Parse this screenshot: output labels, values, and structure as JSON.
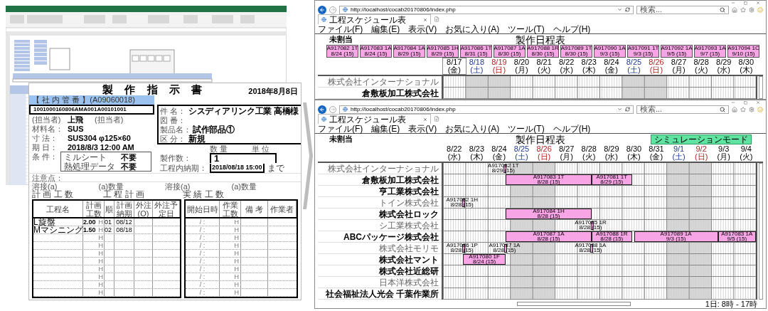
{
  "work_order": {
    "title": "製 作 指 示 書",
    "date": "2018年8月8日",
    "control_label": "【 社 内 管 番 】(A09060018)",
    "code": "1001000160806AMA001A00101001",
    "left_fields": [
      {
        "label": "(担当者)",
        "value": "上飛",
        "extra": "(担当者)"
      },
      {
        "label": "材料名：",
        "value": "SUS"
      },
      {
        "label": "寸 法：",
        "value": "SUS304 φ125×60"
      },
      {
        "label": "期 日：",
        "value": "2018/8/3 12:00 AM"
      }
    ],
    "conditions_label": "条 件：",
    "conditions": [
      {
        "label": "ミルシート",
        "value": "不要"
      },
      {
        "label": "熱処理データ",
        "value": "不要"
      }
    ],
    "right_fields": [
      {
        "label": "件 名：",
        "value": "シスディアリンク工業 高橋様"
      },
      {
        "label": "図 番："
      },
      {
        "label": "製品名：",
        "value": "試作部品①"
      },
      {
        "label": "区 分：",
        "value": "新規"
      }
    ],
    "quantity_headers": [
      "数 量",
      "単 位"
    ],
    "quantity": {
      "label": "製作数：",
      "value": "1"
    },
    "due": {
      "label": "工程内納期：",
      "value": "2018/08/18 15:00",
      "suffix": "まで"
    },
    "notes_label": "注意点：",
    "weld_labels": [
      "溶接(a)",
      "(a)数量",
      "溶接(a)",
      "(a)数量"
    ],
    "sections": [
      "計 画 工 数",
      "工 程 計 画",
      "実 績 工 数"
    ],
    "plan_columns": [
      "工程名",
      "計画工数",
      "順",
      "計画納期",
      "外注(O)",
      "外注予定日"
    ],
    "actual_columns": [
      "開始日時",
      "作業工数",
      "備 考",
      "作業者"
    ],
    "rows": [
      {
        "process": "L旋盤",
        "hours": "2.00",
        "hours_unit": "H",
        "order": "01",
        "due": "08/12",
        "start": "/ :",
        "work_unit": "H"
      },
      {
        "process": "Mマシニング",
        "hours": "1.50",
        "hours_unit": "H",
        "order": "02",
        "due": "08/18",
        "start": "/ :",
        "work_unit": "H"
      },
      {
        "hours_unit": "H",
        "start": "/ :",
        "work_unit": "H"
      },
      {
        "hours_unit": "H",
        "start": "/ :",
        "work_unit": "H"
      },
      {
        "hours_unit": "H",
        "start": "/ :",
        "work_unit": "H"
      },
      {
        "hours_unit": "H",
        "start": "/ :",
        "work_unit": "H"
      },
      {
        "hours_unit": "H",
        "start": "/ :",
        "work_unit": "H"
      },
      {
        "hours_unit": "H",
        "start": "/ :",
        "work_unit": "H"
      },
      {
        "hours_unit": "H",
        "start": "/ :",
        "work_unit": "H"
      },
      {
        "hours_unit": "H",
        "start": "/ :",
        "work_unit": "H"
      }
    ]
  },
  "browsers": [
    {
      "url": "http://localhost/cocab20170806/index.php",
      "search_placeholder": "検索...",
      "tab": "工程スケジュール表",
      "menu": [
        "ファイル(F)",
        "編集(E)",
        "表示(V)",
        "お気に入り(A)",
        "ツール(T)",
        "ヘルプ(H)"
      ],
      "unassigned_label": "未割当",
      "title": "製作日程表",
      "cards": [
        [
          "A917082 1T",
          "8/24 (15)"
        ],
        [
          "A917083 1A",
          "8/24 (15)"
        ],
        [
          "A917084 1A",
          "8/29 (15)"
        ],
        [
          "A917085 1H",
          "8/29 (15)"
        ],
        [
          "A917086 1T",
          "8/31 (15)"
        ],
        [
          "A917087 1A",
          "8/30 (15)"
        ],
        [
          "A917088 1R",
          "8/30 (15)"
        ],
        [
          "A917089 1T",
          "8/30 (15)"
        ],
        [
          "A917090 1A",
          "9/3 (15)"
        ],
        [
          "A917091 1T",
          "9/3 (15)"
        ],
        [
          "A917092 1A",
          "9/5 (15)"
        ],
        [
          "A917093 1A",
          "9/7 (15)"
        ],
        [
          "A917094 1C",
          "9/10 (15)"
        ]
      ],
      "dates": [
        {
          "label": "8/17 (金)",
          "kind": "weekday",
          "today": true
        },
        {
          "label": "8/18 (土)",
          "kind": "sat",
          "today": false
        },
        {
          "label": "8/19 (日)",
          "kind": "sun",
          "today": false
        },
        {
          "label": "8/20 (月)",
          "kind": "weekday",
          "today": false
        },
        {
          "label": "8/21 (火)",
          "kind": "weekday",
          "today": false
        },
        {
          "label": "8/22 (水)",
          "kind": "weekday",
          "today": false
        },
        {
          "label": "8/23 (木)",
          "kind": "weekday",
          "today": false
        },
        {
          "label": "8/24 (金)",
          "kind": "weekday",
          "today": false
        },
        {
          "label": "8/25 (土)",
          "kind": "sat",
          "today": false
        },
        {
          "label": "8/26 (日)",
          "kind": "sun",
          "today": false
        },
        {
          "label": "8/27 (月)",
          "kind": "weekday",
          "today": false
        },
        {
          "label": "8/28 (火)",
          "kind": "weekday",
          "today": false
        },
        {
          "label": "8/29 (水)",
          "kind": "weekday",
          "today": false
        },
        {
          "label": "8/30 (木)",
          "kind": "weekday",
          "today": false
        }
      ],
      "rows": [
        {
          "name": "株式会社インターナショナル",
          "active": false
        },
        {
          "name": "倉敷板加工株式会社",
          "active": true
        }
      ]
    },
    {
      "url": "http://localhost/cocab20170806/index.php",
      "search_placeholder": "検索...",
      "tab": "工程スケジュール表",
      "menu": [
        "ファイル(F)",
        "編集(E)",
        "表示(V)",
        "お気に入り(A)",
        "ツール(T)",
        "ヘルプ(H)"
      ],
      "unassigned_label": "未割当",
      "title": "製作日程表",
      "mode_button": "シミュレーションモード",
      "dates": [
        {
          "label": "8/22 (水)",
          "kind": "weekday",
          "today": false
        },
        {
          "label": "8/23 (木)",
          "kind": "weekday",
          "today": false
        },
        {
          "label": "8/24 (金)",
          "kind": "weekday",
          "today": false
        },
        {
          "label": "8/25 (土)",
          "kind": "sat",
          "today": false
        },
        {
          "label": "8/26 (日)",
          "kind": "sun",
          "today": false
        },
        {
          "label": "8/27 (月)",
          "kind": "weekday",
          "today": false
        },
        {
          "label": "8/28 (火)",
          "kind": "weekday",
          "today": false
        },
        {
          "label": "8/29 (水)",
          "kind": "weekday",
          "today": false
        },
        {
          "label": "8/30 (木)",
          "kind": "weekday",
          "today": false
        },
        {
          "label": "8/31 (金)",
          "kind": "weekday",
          "today": false
        },
        {
          "label": "9/1 (土)",
          "kind": "sat",
          "today": false
        },
        {
          "label": "9/2 (日)",
          "kind": "sun",
          "today": false
        },
        {
          "label": "9/3 (月)",
          "kind": "weekday",
          "today": false
        },
        {
          "label": "9/4 (火)",
          "kind": "weekday",
          "today": false
        }
      ],
      "rows": [
        {
          "name": "株式会社インターナショナル",
          "active": false,
          "bars": [
            {
              "kind": "marker",
              "lines": [
                "A917082 1T",
                "8/29 (15)"
              ]
            }
          ]
        },
        {
          "name": "倉敷板加工株式会社",
          "active": true,
          "bars": [
            {
              "kind": "bar",
              "lines": [
                "A917083 1T",
                "8/28 (15)"
              ]
            },
            {
              "kind": "bar",
              "lines": [
                "A917081 1T",
                "8/29 (15)"
              ]
            }
          ]
        },
        {
          "name": "亨工業株式会社",
          "active": true,
          "bars": []
        },
        {
          "name": "トイン株式会社",
          "active": false,
          "bars": [
            {
              "kind": "marker",
              "lines": [
                "A917082 1H",
                "8/28 (15)"
              ]
            }
          ]
        },
        {
          "name": "株式会社ロック",
          "active": true,
          "bars": [
            {
              "kind": "bar",
              "lines": [
                "A917084 1H",
                "8/28 (15)"
              ]
            }
          ]
        },
        {
          "name": "シ工業株式会社",
          "active": false,
          "bars": [
            {
              "kind": "marker",
              "lines": [
                "A917085 1R",
                "8/28 (15)"
              ]
            }
          ]
        },
        {
          "name": "ABCパッケージ株式会社",
          "active": true,
          "bars": [
            {
              "kind": "bar",
              "lines": [
                "A917087 1A",
                "8/28 (15)"
              ]
            },
            {
              "kind": "bar",
              "lines": [
                "A917088 1R",
                "8/28 (15)"
              ]
            },
            {
              "kind": "bar",
              "lines": [
                "A917089 1A",
                "9/3 (15)"
              ]
            },
            {
              "kind": "bar",
              "lines": [
                "A917083 1A",
                "9/5 (15)"
              ]
            }
          ]
        },
        {
          "name": "株式会社モリモ",
          "active": false,
          "bars": [
            {
              "kind": "marker",
              "lines": [
                "A917086 1P",
                "8/28 (15)"
              ]
            },
            {
              "kind": "marker",
              "lines": [
                "A917087 1A",
                "8/28 (15)"
              ]
            },
            {
              "kind": "marker",
              "lines": [
                "A917088 1A",
                "8/28 (15)"
              ]
            }
          ]
        },
        {
          "name": "株式会社マント",
          "active": true,
          "bars": [
            {
              "kind": "bar",
              "lines": [
                "A917080 1F",
                "8/24 (15)"
              ]
            }
          ]
        },
        {
          "name": "株式会社近総研",
          "active": true,
          "bars": []
        },
        {
          "name": "日本洋株式会社",
          "active": false,
          "bars": []
        },
        {
          "name": "社会福祉法人光会 千葉作業所",
          "active": true,
          "bars": []
        }
      ],
      "footer": "1日: 8時 - 17時"
    }
  ]
}
